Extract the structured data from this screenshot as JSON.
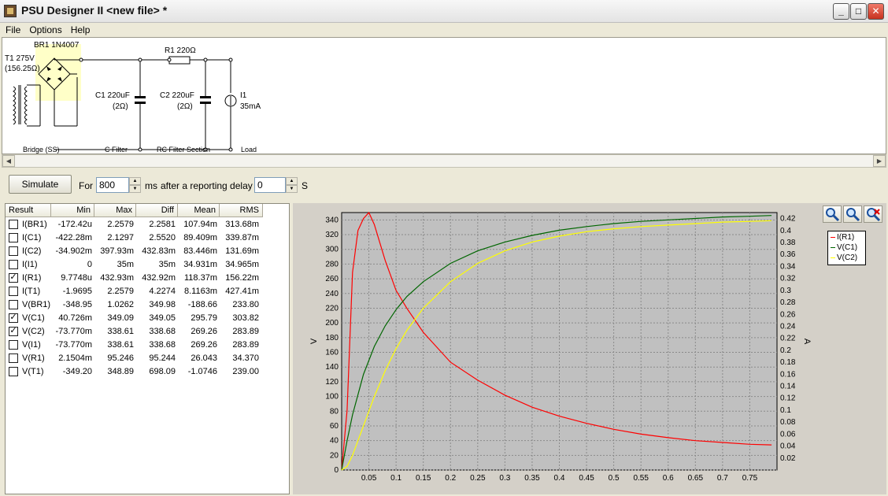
{
  "window": {
    "title": "PSU Designer II  <new file> *"
  },
  "menu": [
    "File",
    "Options",
    "Help"
  ],
  "schematic": {
    "transformer": "T1 275V",
    "transformer_res": "(156.25Ω)",
    "bridge": "BR1 1N4007",
    "r1": "R1 220Ω",
    "c1": "C1 220uF",
    "c1_esr": "(2Ω)",
    "c2": "C2 220uF",
    "c2_esr": "(2Ω)",
    "load_name": "I1",
    "load_value": "35mA",
    "sections": [
      "Bridge (SS)",
      "C Filter",
      "RC Filter Section",
      "Load"
    ]
  },
  "simbar": {
    "simulate_label": "Simulate",
    "for_label": "For",
    "duration": "800",
    "ms_label": "ms",
    "delay_label": "after a reporting delay of",
    "delay": "0",
    "s_label": "S"
  },
  "results": {
    "columns": [
      "Result",
      "Min",
      "Max",
      "Diff",
      "Mean",
      "RMS"
    ],
    "rows": [
      {
        "name": "I(BR1)",
        "checked": false,
        "min": "-172.42u",
        "max": "2.2579",
        "diff": "2.2581",
        "mean": "107.94m",
        "rms": "313.68m"
      },
      {
        "name": "I(C1)",
        "checked": false,
        "min": "-422.28m",
        "max": "2.1297",
        "diff": "2.5520",
        "mean": "89.409m",
        "rms": "339.87m"
      },
      {
        "name": "I(C2)",
        "checked": false,
        "min": "-34.902m",
        "max": "397.93m",
        "diff": "432.83m",
        "mean": "83.446m",
        "rms": "131.69m"
      },
      {
        "name": "I(I1)",
        "checked": false,
        "min": "0",
        "max": "35m",
        "diff": "35m",
        "mean": "34.931m",
        "rms": "34.965m"
      },
      {
        "name": "I(R1)",
        "checked": true,
        "min": "9.7748u",
        "max": "432.93m",
        "diff": "432.92m",
        "mean": "118.37m",
        "rms": "156.22m"
      },
      {
        "name": "I(T1)",
        "checked": false,
        "min": "-1.9695",
        "max": "2.2579",
        "diff": "4.2274",
        "mean": "8.1163m",
        "rms": "427.41m"
      },
      {
        "name": "V(BR1)",
        "checked": false,
        "min": "-348.95",
        "max": "1.0262",
        "diff": "349.98",
        "mean": "-188.66",
        "rms": "233.80"
      },
      {
        "name": "V(C1)",
        "checked": true,
        "min": "40.726m",
        "max": "349.09",
        "diff": "349.05",
        "mean": "295.79",
        "rms": "303.82"
      },
      {
        "name": "V(C2)",
        "checked": true,
        "min": "-73.770m",
        "max": "338.61",
        "diff": "338.68",
        "mean": "269.26",
        "rms": "283.89"
      },
      {
        "name": "V(I1)",
        "checked": false,
        "min": "-73.770m",
        "max": "338.61",
        "diff": "338.68",
        "mean": "269.26",
        "rms": "283.89"
      },
      {
        "name": "V(R1)",
        "checked": false,
        "min": "2.1504m",
        "max": "95.246",
        "diff": "95.244",
        "mean": "26.043",
        "rms": "34.370"
      },
      {
        "name": "V(T1)",
        "checked": false,
        "min": "-349.20",
        "max": "348.89",
        "diff": "698.09",
        "mean": "-1.0746",
        "rms": "239.00"
      }
    ]
  },
  "chart_data": {
    "type": "line",
    "xlabel": "",
    "ylabel_left": "V",
    "ylabel_right": "A",
    "xlim": [
      0,
      0.8
    ],
    "ylim_left": [
      0,
      350
    ],
    "ylim_right": [
      0,
      0.43
    ],
    "xticks": [
      "0.05",
      "0.1",
      "0.15",
      "0.2",
      "0.25",
      "0.3",
      "0.35",
      "0.4",
      "0.45",
      "0.5",
      "0.55",
      "0.6",
      "0.65",
      "0.7",
      "0.75"
    ],
    "yticks_left": [
      "0",
      "20",
      "40",
      "60",
      "80",
      "100",
      "120",
      "140",
      "160",
      "180",
      "200",
      "220",
      "240",
      "260",
      "280",
      "300",
      "320",
      "340"
    ],
    "yticks_right": [
      "0.02",
      "0.04",
      "0.06",
      "0.08",
      "0.1",
      "0.12",
      "0.14",
      "0.16",
      "0.18",
      "0.2",
      "0.22",
      "0.24",
      "0.26",
      "0.28",
      "0.3",
      "0.32",
      "0.34",
      "0.36",
      "0.38",
      "0.4",
      "0.42"
    ],
    "grid": true,
    "legend_position": "right",
    "series": [
      {
        "name": "I(R1)",
        "axis": "right",
        "color": "#ff0000",
        "x": [
          0,
          0.01,
          0.02,
          0.03,
          0.04,
          0.05,
          0.06,
          0.08,
          0.1,
          0.12,
          0.15,
          0.2,
          0.25,
          0.3,
          0.35,
          0.4,
          0.45,
          0.5,
          0.55,
          0.6,
          0.65,
          0.7,
          0.75,
          0.79
        ],
        "y": [
          0,
          0.1,
          0.33,
          0.4,
          0.42,
          0.43,
          0.41,
          0.35,
          0.3,
          0.27,
          0.23,
          0.18,
          0.15,
          0.125,
          0.105,
          0.09,
          0.078,
          0.068,
          0.06,
          0.054,
          0.049,
          0.046,
          0.043,
          0.042
        ]
      },
      {
        "name": "V(C1)",
        "axis": "left",
        "color": "#006600",
        "x": [
          0,
          0.01,
          0.02,
          0.04,
          0.06,
          0.08,
          0.1,
          0.12,
          0.15,
          0.2,
          0.25,
          0.3,
          0.35,
          0.4,
          0.45,
          0.5,
          0.55,
          0.6,
          0.65,
          0.7,
          0.75,
          0.79
        ],
        "y": [
          0,
          40,
          75,
          130,
          168,
          196,
          218,
          236,
          256,
          281,
          298,
          310,
          319,
          326,
          331,
          335,
          338,
          340,
          342,
          344,
          345,
          346
        ]
      },
      {
        "name": "V(C2)",
        "axis": "left",
        "color": "#ffff00",
        "x": [
          0,
          0.01,
          0.02,
          0.04,
          0.06,
          0.08,
          0.1,
          0.12,
          0.15,
          0.2,
          0.25,
          0.3,
          0.35,
          0.4,
          0.45,
          0.5,
          0.55,
          0.6,
          0.65,
          0.7,
          0.75,
          0.79
        ],
        "y": [
          0,
          5,
          20,
          60,
          100,
          135,
          165,
          190,
          220,
          256,
          281,
          298,
          310,
          318,
          324,
          328,
          331,
          333,
          335,
          337,
          338,
          339
        ]
      }
    ]
  }
}
